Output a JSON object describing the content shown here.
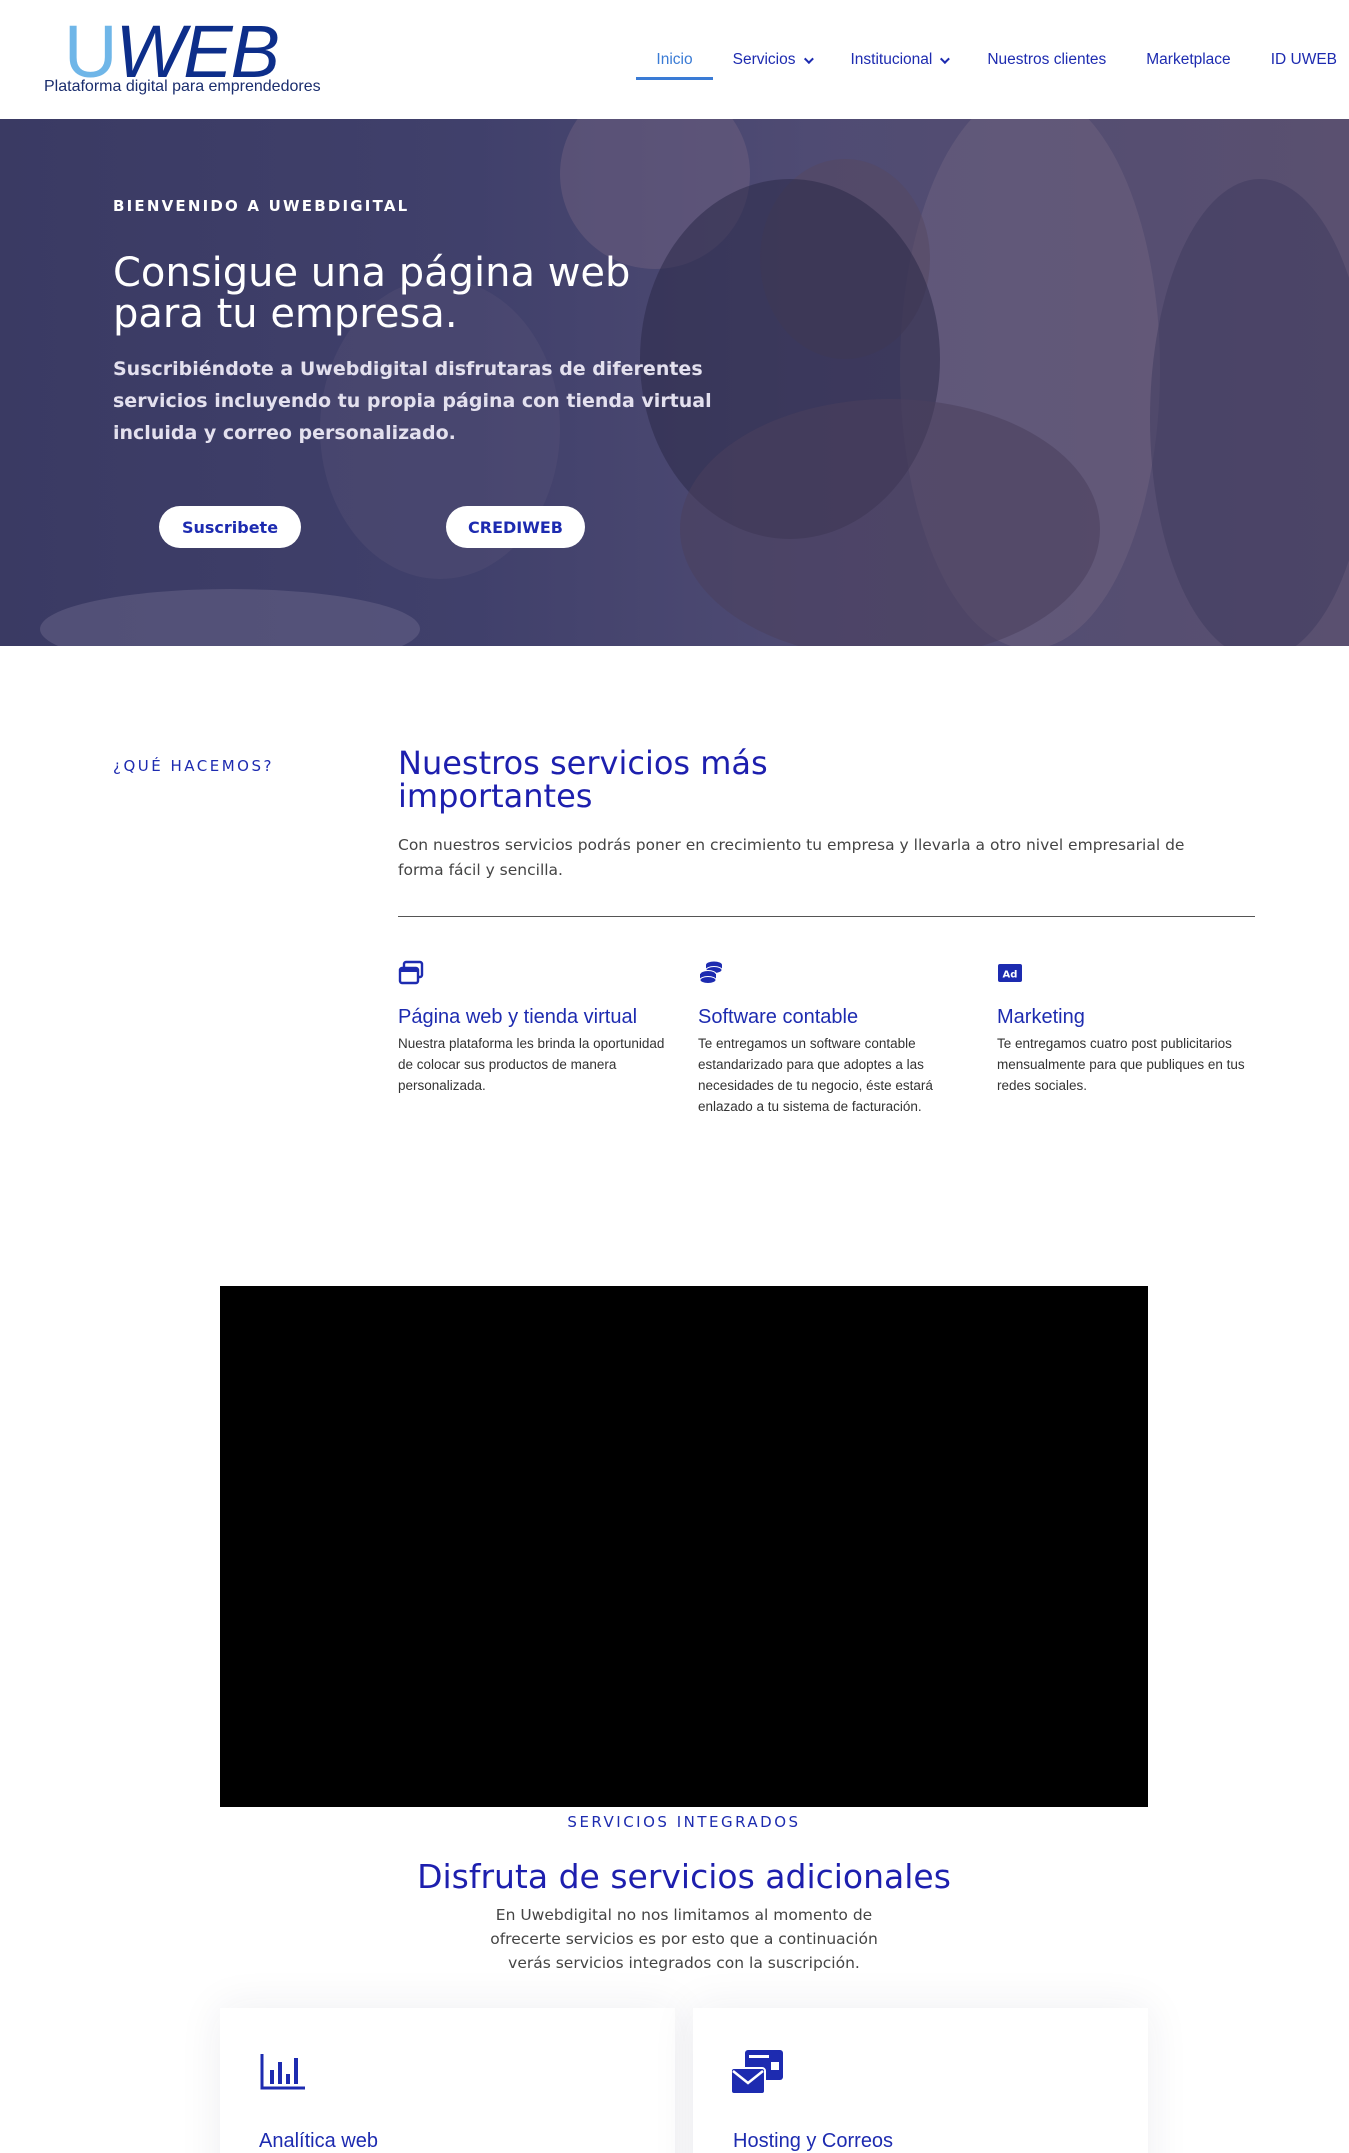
{
  "header": {
    "logo_u": "U",
    "logo_web": "WEB",
    "logo_tagline": "Plataforma digital para emprendedores",
    "nav": [
      {
        "label": "Inicio",
        "active": true,
        "dropdown": false
      },
      {
        "label": "Servicios",
        "active": false,
        "dropdown": true
      },
      {
        "label": "Institucional",
        "active": false,
        "dropdown": true
      },
      {
        "label": "Nuestros clientes",
        "active": false,
        "dropdown": false
      },
      {
        "label": "Marketplace",
        "active": false,
        "dropdown": false
      },
      {
        "label": "ID UWEB",
        "active": false,
        "dropdown": false
      }
    ]
  },
  "hero": {
    "kicker": "BIENVENIDO A UWEBDIGITAL",
    "title": "Consigue una página web para tu empresa.",
    "subtitle": "Suscribiéndote a Uwebdigital disfrutaras de diferentes servicios incluyendo tu propia página con tienda virtual incluida y correo personalizado.",
    "buttons": {
      "subscribe": "Suscribete",
      "crediweb": "CREDIWEB"
    }
  },
  "services": {
    "kicker": "¿QUÉ HACEMOS?",
    "title": "Nuestros servicios más importantes",
    "description": "Con nuestros servicios podrás poner en crecimiento tu empresa y llevarla a otro nivel empresarial de forma fácil y sencilla.",
    "cards": [
      {
        "icon": "window-icon",
        "title": "Página web y tienda virtual",
        "text": "Nuestra plataforma les brinda la oportunidad de colocar sus productos de manera personalizada."
      },
      {
        "icon": "coins-icon",
        "title": "Software contable",
        "text": "Te entregamos un software contable estandarizado para que adoptes a las necesidades de tu negocio, éste estará enlazado a tu sistema de facturación."
      },
      {
        "icon": "ad-icon",
        "title": "Marketing",
        "text": "Te entregamos cuatro post publicitarios mensualmente para que publiques en tus redes sociales."
      }
    ]
  },
  "integrated": {
    "kicker": "SERVICIOS INTEGRADOS",
    "title": "Disfruta de servicios adicionales",
    "description": "En Uwebdigital no nos limitamos al momento de ofrecerte servicios es por esto que a continuación verás servicios integrados con la suscripción.",
    "panels": [
      {
        "icon": "bar-chart-icon",
        "title": "Analítica web"
      },
      {
        "icon": "mail-card-icon",
        "title": "Hosting y Correos"
      }
    ]
  },
  "colors": {
    "accent": "#1d2bb0",
    "active_nav": "#3a7bd5",
    "hero_overlay": "#3f3e6a",
    "logo_u": "#6fb6e8",
    "logo_web": "#0d2e8a"
  }
}
